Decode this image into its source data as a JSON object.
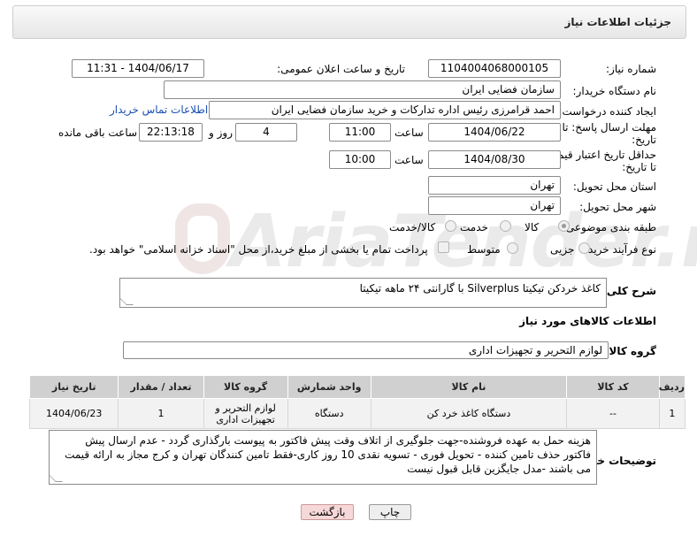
{
  "header": {
    "title": "جزئیات اطلاعات نیاز"
  },
  "fields": {
    "need_number_label": "شماره نیاز:",
    "need_number": "1104004068000105",
    "announce_label": "تاریخ و ساعت اعلان عمومی:",
    "announce_value": "1404/06/17 - 11:31",
    "buyer_org_label": "نام دستگاه خریدار:",
    "buyer_org": "سازمان فضایی ایران",
    "creator_label": "ایجاد کننده درخواست:",
    "creator": "احمد قرامرزی رئیس اداره تدارکات و خرید سازمان فضایی ایران",
    "contact_link": "اطلاعات تماس خریدار",
    "deadline_label_1": "مهلت ارسال پاسخ: تا",
    "deadline_label_2": "تاریخ:",
    "deadline_date": "1404/06/22",
    "time_label": "ساعت",
    "deadline_time": "11:00",
    "days_value": "4",
    "days_label": "روز و",
    "remaining_value": "22:13:18",
    "remaining_label": "ساعت باقی مانده",
    "validity_label_1": "حداقل تاریخ اعتبار قیمت:",
    "validity_label_2": "تا تاریخ:",
    "validity_date": "1404/08/30",
    "validity_time": "10:00",
    "province_label": "استان محل تحویل:",
    "province": "تهران",
    "city_label": "شهر محل تحویل:",
    "city": "تهران",
    "category_label": "طبقه بندی موضوعی:",
    "category_options": [
      "کالا",
      "خدمت",
      "کالا/خدمت"
    ],
    "category_selected": "کالا",
    "process_label": "نوع فرآیند خرید :",
    "process_options": [
      "جزیی",
      "متوسط"
    ],
    "payment_note": "پرداخت تمام یا بخشی از مبلغ خرید،از محل \"اسناد خزانه اسلامی\" خواهد بود.",
    "description_label": "شرح کلی نیاز:",
    "description": "کاغذ خردکن تیکیتا Silverplus با گارانتی ۲۴ ماهه تیکیتا",
    "goods_info_title": "اطلاعات کالاهای مورد نیاز",
    "goods_group_label": "گروه کالا:",
    "goods_group": "لوازم التحریر و تجهیزات اداری"
  },
  "table": {
    "headers": [
      "ردیف",
      "کد کالا",
      "نام کالا",
      "واحد شمارش",
      "گروه کالا",
      "تعداد / مقدار",
      "تاریخ نیاز"
    ],
    "rows": [
      [
        "1",
        "--",
        "دستگاه کاغذ خرد کن",
        "دستگاه",
        "لوازم التحریر و تجهیزات اداری",
        "1",
        "1404/06/23"
      ]
    ]
  },
  "notes": {
    "label": "توضیحات خریدار:",
    "text": "هزینه حمل به عهده فروشنده-جهت جلوگیری از اتلاف وقت پیش فاکتور به پیوست بارگذاری گردد - عدم ارسال پیش فاکتور حذف تامین کننده - تحویل فوری - تسویه نقدی 10 روز کاری-فقط تامین کنندگان تهران و کرج مجاز به ارائه قیمت می باشند -مدل جایگزین قابل قبول نیست"
  },
  "buttons": {
    "print": "چاپ",
    "back": "بازگشت"
  },
  "watermark": {
    "text": "AriaTender.net"
  }
}
